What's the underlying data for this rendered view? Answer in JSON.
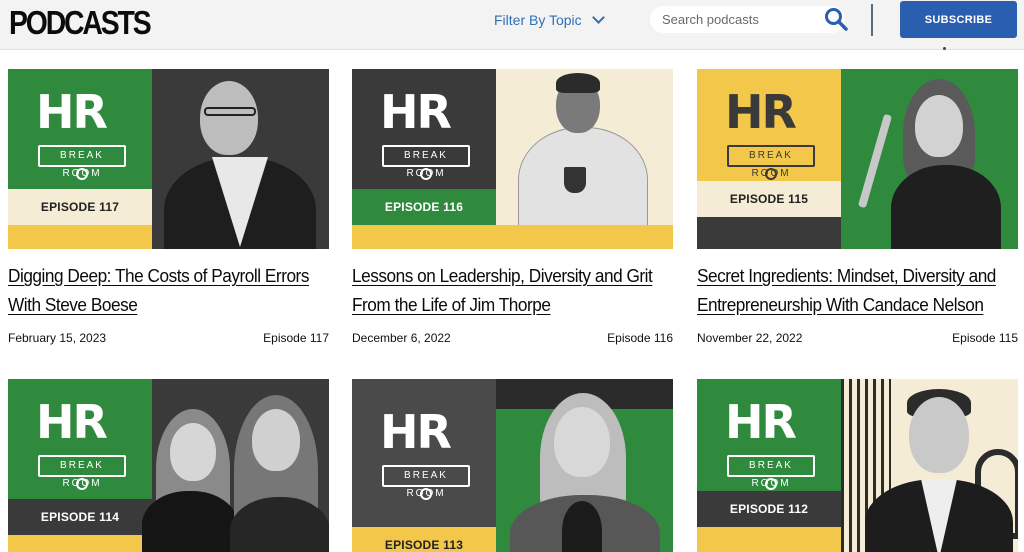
{
  "header": {
    "brand": "PODCASTS",
    "filter_label": "Filter By Topic",
    "search_placeholder": "Search podcasts",
    "subscribe_label": "SUBSCRIBE"
  },
  "logo": {
    "mark": "HR",
    "sub": "BREAK ROOM"
  },
  "colors": {
    "green": "#2f8a3e",
    "dark": "#3a3a3a",
    "cream": "#f4ecd5",
    "yellow": "#f3c84a",
    "blue": "#2a5fb0"
  },
  "episodes": [
    {
      "tag": "EPISODE 117",
      "title": "Digging Deep: The Costs of Payroll Errors With Steve Boese",
      "date": "February 15, 2023",
      "episode": "Episode 117"
    },
    {
      "tag": "EPISODE 116",
      "title": "Lessons on Leadership, Diversity and Grit From the Life of Jim Thorpe",
      "date": "December 6, 2022",
      "episode": "Episode 116"
    },
    {
      "tag": "EPISODE 115",
      "title": "Secret Ingredients: Mindset, Diversity and Entrepreneurship With Candace Nelson",
      "date": "November 22, 2022",
      "episode": "Episode 115"
    },
    {
      "tag": "EPISODE 114"
    },
    {
      "tag": "EPISODE 113"
    },
    {
      "tag": "EPISODE 112"
    }
  ]
}
